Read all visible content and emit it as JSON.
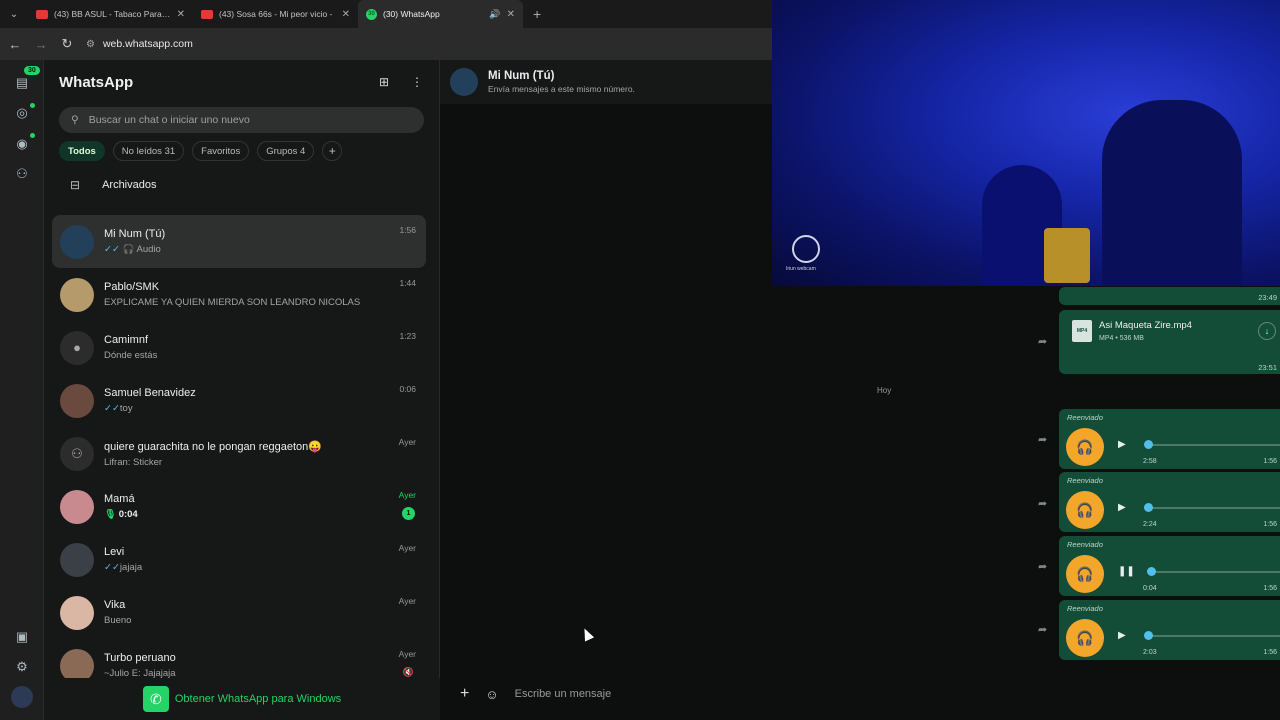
{
  "browser": {
    "tabs": [
      {
        "title": "(43) BB ASUL - Tabaco Para Ar",
        "favicon": "youtube-icon"
      },
      {
        "title": "(43) Sosa 66s - Mi peor vicio - ",
        "favicon": "youtube-icon"
      },
      {
        "title": "(30) WhatsApp",
        "favicon": "whatsapp-icon",
        "badge": "30"
      }
    ],
    "url": "web.whatsapp.com"
  },
  "rail": {
    "chats_badge": "30"
  },
  "sidebar": {
    "title": "WhatsApp",
    "search_placeholder": "Buscar un chat o iniciar uno nuevo",
    "filters": [
      "Todos",
      "No leídos 31",
      "Favoritos",
      "Grupos 4"
    ],
    "archived": "Archivados",
    "chats": [
      {
        "name": "Mi Num (Tú)",
        "msg": "Audio",
        "time": "1:56"
      },
      {
        "name": "Pablo/SMK",
        "msg": "EXPLICAME YA QUIEN MIERDA SON LEANDRO NICOLAS",
        "time": "1:44"
      },
      {
        "name": "Camimnf",
        "msg": "Dónde estás",
        "time": "1:23"
      },
      {
        "name": "Samuel Benavidez",
        "msg": "toy",
        "time": "0:06"
      },
      {
        "name": "quiere guarachita no le pongan reggaeton😛",
        "msg": "Lifran: Sticker",
        "time": "Ayer"
      },
      {
        "name": "Mamá",
        "msg": "0:04",
        "time": "Ayer",
        "unread": "1"
      },
      {
        "name": "Levi",
        "msg": "jajaja",
        "time": "Ayer"
      },
      {
        "name": "Vika",
        "msg": "Bueno",
        "time": "Ayer"
      },
      {
        "name": "Turbo peruano",
        "msg": "~Julio E: Jajajaja",
        "time": "Ayer"
      }
    ],
    "promo": "Obtener WhatsApp para Windows"
  },
  "conversation": {
    "name": "Mi Num (Tú)",
    "subtitle": "Envía mensajes a este mismo número.",
    "prev_time": "23:49",
    "file": {
      "name": "Asi Maqueta Zire.mp4",
      "meta": "MP4 • 536 MB",
      "time": "23:51"
    },
    "day": "Hoy",
    "audios": [
      {
        "label": "Reenviado",
        "duration": "2:58",
        "time": "1:56"
      },
      {
        "label": "Reenviado",
        "duration": "2:24",
        "time": "1:56"
      },
      {
        "label": "Reenviado",
        "duration": "0:04",
        "time": "1:56"
      },
      {
        "label": "Reenviado",
        "duration": "2:03",
        "time": "1:56"
      }
    ],
    "composer_placeholder": "Escribe un mensaje"
  },
  "webcam": {
    "label": "Iriun webcam"
  }
}
